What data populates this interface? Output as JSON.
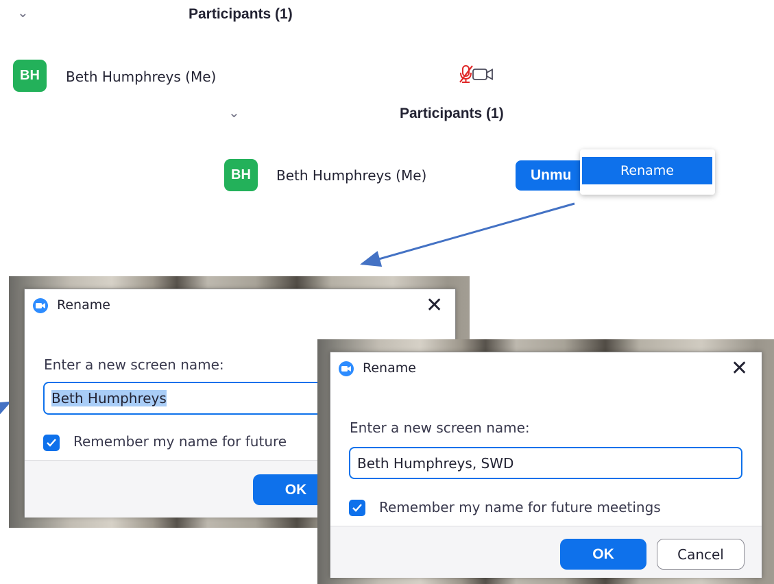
{
  "panel1": {
    "chevron": "⌄",
    "title": "Participants (1)",
    "participant": {
      "initials": "BH",
      "name": "Beth Humphreys (Me)",
      "avatar_color": "#23b15a"
    },
    "status_icons": [
      "muted-mic-icon",
      "video-camera-icon"
    ],
    "muted_color": "#e02828"
  },
  "panel2": {
    "chevron": "⌄",
    "title": "Participants (1)",
    "participant": {
      "initials": "BH",
      "name": "Beth Humphreys (Me)"
    },
    "unmute_label": "Unmu",
    "context_menu": {
      "items": [
        "Rename"
      ]
    }
  },
  "dialog_before": {
    "title": "Rename",
    "prompt": "Enter a new screen name:",
    "input_value": "Beth Humphreys",
    "checkbox_label": "Remember my name for future",
    "checkbox_checked": true,
    "ok_label": "OK"
  },
  "dialog_after": {
    "title": "Rename",
    "prompt": "Enter a new screen name:",
    "input_value": "Beth Humphreys, SWD",
    "checkbox_label": "Remember my name for future meetings",
    "checkbox_checked": true,
    "ok_label": "OK",
    "cancel_label": "Cancel"
  },
  "colors": {
    "accent": "#0e71eb",
    "arrow": "#4472c4",
    "selection": "#a9cdf7"
  }
}
